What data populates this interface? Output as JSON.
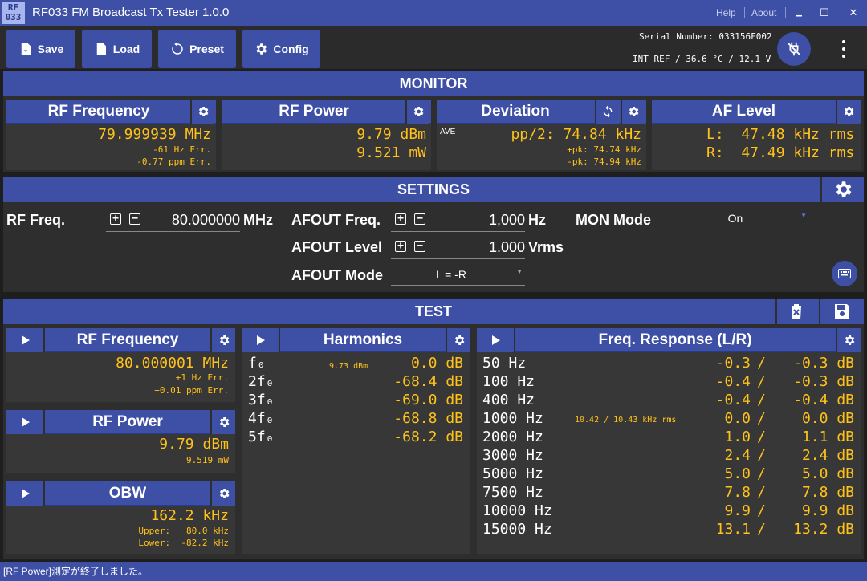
{
  "window": {
    "logo": "RF\n033",
    "title": "RF033 FM Broadcast Tx Tester 1.0.0",
    "help": "Help",
    "about": "About",
    "minimize": "▁",
    "maximize": "☐",
    "close": "✕"
  },
  "toolbar": {
    "save": "Save",
    "load": "Load",
    "preset": "Preset",
    "config": "Config",
    "serial_label": "Serial Number:",
    "serial_value": "033156F002",
    "intref": "INT REF / 36.6 °C / 12.1 V"
  },
  "monitor": {
    "title": "MONITOR",
    "rf_freq": {
      "title": "RF Frequency",
      "value": "79.999939 MHz",
      "err_hz": "-61 Hz Err.",
      "err_ppm": "-0.77 ppm Err."
    },
    "rf_power": {
      "title": "RF Power",
      "dbm": "9.79 dBm",
      "mw": "9.521 mW"
    },
    "deviation": {
      "title": "Deviation",
      "mode": "AVE",
      "pp2": "pp/2: 74.84 kHz",
      "pk_pos": "+pk: 74.74 kHz",
      "pk_neg": "-pk: 74.94 kHz"
    },
    "af_level": {
      "title": "AF Level",
      "left": "L:  47.48 kHz rms",
      "right": "R:  47.49 kHz rms"
    }
  },
  "settings": {
    "title": "SETTINGS",
    "rf_freq_label": "RF Freq.",
    "rf_freq_value": "80.000000",
    "rf_freq_unit": "MHz",
    "afout_freq_label": "AFOUT Freq.",
    "afout_freq_value": "1,000",
    "afout_freq_unit": "Hz",
    "afout_level_label": "AFOUT Level",
    "afout_level_value": "1.000",
    "afout_level_unit": "Vrms",
    "afout_mode_label": "AFOUT Mode",
    "afout_mode_value": "L = -R",
    "mon_mode_label": "MON Mode",
    "mon_mode_value": "On",
    "plus": "+",
    "minus": "−"
  },
  "test": {
    "title": "TEST",
    "rf_freq": {
      "title": "RF Frequency",
      "value": "80.000001 MHz",
      "err_hz": "+1 Hz Err.",
      "err_ppm": "+0.01 ppm Err."
    },
    "rf_power": {
      "title": "RF Power",
      "dbm": "9.79 dBm",
      "mw": "9.519 mW"
    },
    "obw": {
      "title": "OBW",
      "value": "162.2 kHz",
      "upper": "Upper:   80.0 kHz",
      "lower": "Lower:  -82.2 kHz"
    },
    "harmonics": {
      "title": "Harmonics",
      "fund_level": "9.73 dBm",
      "rows": [
        {
          "label": "f₀",
          "value": "0.0 dB"
        },
        {
          "label": "2f₀",
          "value": "-68.4 dB"
        },
        {
          "label": "3f₀",
          "value": "-69.0 dB"
        },
        {
          "label": "4f₀",
          "value": "-68.8 dB"
        },
        {
          "label": "5f₀",
          "value": "-68.2 dB"
        }
      ]
    },
    "freq_response": {
      "title": "Freq. Response (L/R)",
      "ref_level": "10.42 / 10.43 kHz rms",
      "rows": [
        {
          "freq": "50 Hz",
          "l": "-0.3",
          "r": "-0.3 dB"
        },
        {
          "freq": "100 Hz",
          "l": "-0.4",
          "r": "-0.3 dB"
        },
        {
          "freq": "400 Hz",
          "l": "-0.4",
          "r": "-0.4 dB"
        },
        {
          "freq": "1000 Hz",
          "l": "0.0",
          "r": "0.0 dB"
        },
        {
          "freq": "2000 Hz",
          "l": "1.0",
          "r": "1.1 dB"
        },
        {
          "freq": "3000 Hz",
          "l": "2.4",
          "r": "2.4 dB"
        },
        {
          "freq": "5000 Hz",
          "l": "5.0",
          "r": "5.0 dB"
        },
        {
          "freq": "7500 Hz",
          "l": "7.8",
          "r": "7.8 dB"
        },
        {
          "freq": "10000 Hz",
          "l": "9.9",
          "r": "9.9 dB"
        },
        {
          "freq": "15000 Hz",
          "l": "13.1",
          "r": "13.2 dB"
        }
      ],
      "sep": "/"
    }
  },
  "status": "[RF Power]測定が終了しました。",
  "colors": {
    "accent": "#3e4fa6",
    "value": "#ffc21a",
    "panel": "#373737"
  }
}
